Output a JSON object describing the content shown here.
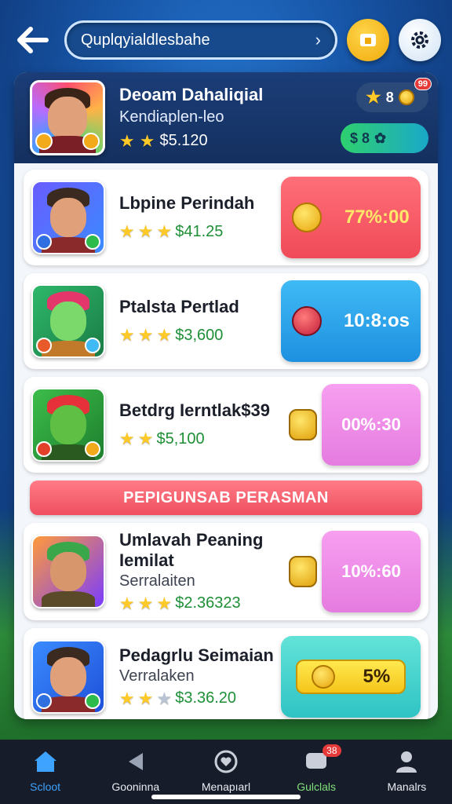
{
  "topbar": {
    "search_text": "Quplqyialdlesbahe",
    "search_chevron": "›"
  },
  "header": {
    "title": "Deoam Dahaliqial",
    "subtitle": "Kendiaplen-leo",
    "price": "$5.120",
    "pill_stars": "8",
    "pill_badge": "99",
    "pill_green": "$ 8"
  },
  "items": [
    {
      "title": "Lbpine Perindah",
      "subtitle": "",
      "price": "$41.25",
      "deal": "77%:00",
      "color": "red"
    },
    {
      "title": "Ptalsta Pertlad",
      "subtitle": "",
      "price": "$3,600",
      "deal": "10:8:os",
      "color": "blue"
    },
    {
      "title": "Betdrg Ierntlak$39",
      "subtitle": "",
      "price": "$5,100",
      "deal": "00%:30",
      "color": "pink"
    }
  ],
  "banner": "PEPIGUNSAB PERASMAN",
  "items2": [
    {
      "title": "Umlavah Peaning Iemilat",
      "subtitle": "Serralaiten",
      "price": "$2.36323",
      "deal": "10%:60"
    },
    {
      "title": "Pedagrlu Seimaian",
      "subtitle": "Verralaken",
      "price": "$3.36.20",
      "deal": "5%"
    }
  ],
  "nav": [
    {
      "label": "Scloot",
      "icon": "home-icon"
    },
    {
      "label": "Gooninna",
      "icon": "play-icon"
    },
    {
      "label": "Menapıarl",
      "icon": "heart-icon"
    },
    {
      "label": "Gulclals",
      "icon": "chat-icon",
      "badge": "38"
    },
    {
      "label": "Manalrs",
      "icon": "profile-icon"
    }
  ]
}
